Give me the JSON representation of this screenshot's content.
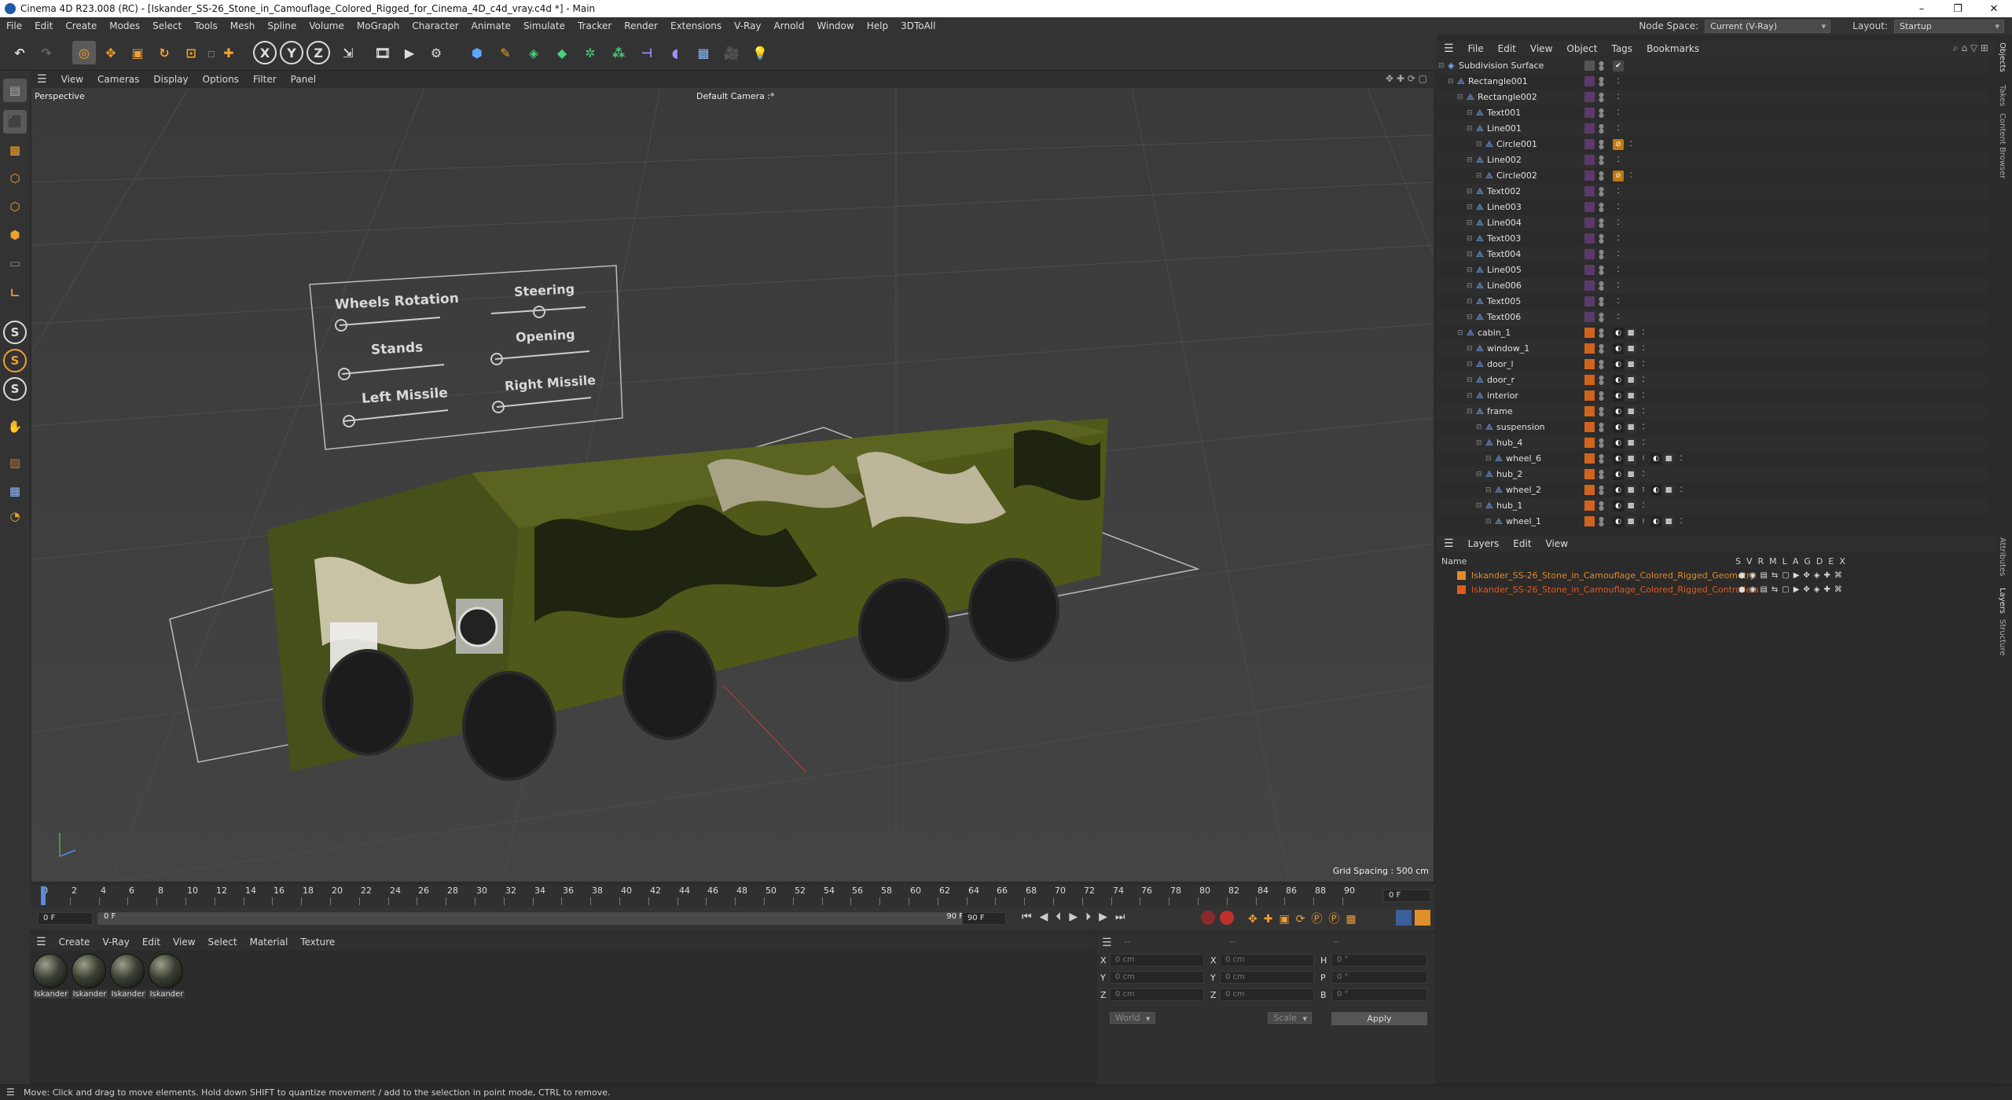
{
  "window": {
    "title": "Cinema 4D R23.008 (RC) - [Iskander_SS-26_Stone_in_Camouflage_Colored_Rigged_for_Cinema_4D_c4d_vray.c4d *] - Main",
    "min": "–",
    "max": "❐",
    "close": "✕"
  },
  "menubar": {
    "items": [
      "File",
      "Edit",
      "Create",
      "Modes",
      "Select",
      "Tools",
      "Mesh",
      "Spline",
      "Volume",
      "MoGraph",
      "Character",
      "Animate",
      "Simulate",
      "Tracker",
      "Render",
      "Extensions",
      "V-Ray",
      "Arnold",
      "Window",
      "Help",
      "3DToAll"
    ],
    "node_space_label": "Node Space:",
    "node_space_value": "Current (V-Ray)",
    "layout_label": "Layout:",
    "layout_value": "Startup"
  },
  "toolbar": {
    "axis": [
      "X",
      "Y",
      "Z"
    ]
  },
  "viewport": {
    "menu": [
      "View",
      "Cameras",
      "Display",
      "Options",
      "Filter",
      "Panel"
    ],
    "view_name": "Perspective",
    "camera": "Default Camera :*",
    "grid_spacing": "Grid Spacing : 500 cm",
    "hud": {
      "wheels_rotation": "Wheels Rotation",
      "steering": "Steering",
      "stands": "Stands",
      "opening": "Opening",
      "left_missile": "Left Missile",
      "right_missile": "Right Missile"
    }
  },
  "timeline": {
    "ticks": [
      "0",
      "2",
      "4",
      "6",
      "8",
      "10",
      "12",
      "14",
      "16",
      "18",
      "20",
      "22",
      "24",
      "26",
      "28",
      "30",
      "32",
      "34",
      "36",
      "38",
      "40",
      "42",
      "44",
      "46",
      "48",
      "50",
      "52",
      "54",
      "56",
      "58",
      "60",
      "62",
      "64",
      "66",
      "68",
      "70",
      "72",
      "74",
      "76",
      "78",
      "80",
      "82",
      "84",
      "86",
      "88",
      "90"
    ],
    "current_frame": "0 F",
    "start": "0 F",
    "range_start": "0 F",
    "range_end": "90 F",
    "end": "90 F"
  },
  "materials": {
    "menu": [
      "Create",
      "V-Ray",
      "Edit",
      "View",
      "Select",
      "Material",
      "Texture"
    ],
    "items": [
      "Iskander",
      "Iskander",
      "Iskander",
      "Iskander"
    ]
  },
  "coords": {
    "labels_left": [
      "X",
      "Y",
      "Z"
    ],
    "labels_mid": [
      "X",
      "Y",
      "Z"
    ],
    "labels_right": [
      "H",
      "P",
      "B"
    ],
    "values": [
      "0 cm",
      "0 cm",
      "0 cm"
    ],
    "rot_values": [
      "0 °",
      "0 °",
      "0 °"
    ],
    "world": "World",
    "scale": "Scale",
    "apply": "Apply",
    "dashes": "--"
  },
  "status": "Move: Click and drag to move elements. Hold down SHIFT to quantize movement / add to the selection in point mode, CTRL to remove.",
  "objects": {
    "menu": [
      "File",
      "Edit",
      "View",
      "Object",
      "Tags",
      "Bookmarks"
    ],
    "rows": [
      {
        "name": "Subdivision Surface",
        "indent": 0
      },
      {
        "name": "Rectangle001",
        "indent": 1
      },
      {
        "name": "Rectangle002",
        "indent": 2
      },
      {
        "name": "Text001",
        "indent": 3
      },
      {
        "name": "Line001",
        "indent": 3
      },
      {
        "name": "Circle001",
        "indent": 4
      },
      {
        "name": "Line002",
        "indent": 3
      },
      {
        "name": "Circle002",
        "indent": 4
      },
      {
        "name": "Text002",
        "indent": 3
      },
      {
        "name": "Line003",
        "indent": 3
      },
      {
        "name": "Line004",
        "indent": 3
      },
      {
        "name": "Text003",
        "indent": 3
      },
      {
        "name": "Text004",
        "indent": 3
      },
      {
        "name": "Line005",
        "indent": 3
      },
      {
        "name": "Line006",
        "indent": 3
      },
      {
        "name": "Text005",
        "indent": 3
      },
      {
        "name": "Text006",
        "indent": 3
      },
      {
        "name": "cabin_1",
        "indent": 2
      },
      {
        "name": "window_1",
        "indent": 3
      },
      {
        "name": "door_l",
        "indent": 3
      },
      {
        "name": "door_r",
        "indent": 3
      },
      {
        "name": "interior",
        "indent": 3
      },
      {
        "name": "frame",
        "indent": 3
      },
      {
        "name": "suspension",
        "indent": 4
      },
      {
        "name": "hub_4",
        "indent": 4
      },
      {
        "name": "wheel_6",
        "indent": 5
      },
      {
        "name": "hub_2",
        "indent": 4
      },
      {
        "name": "wheel_2",
        "indent": 5
      },
      {
        "name": "hub_1",
        "indent": 4
      },
      {
        "name": "wheel_1",
        "indent": 5
      }
    ]
  },
  "layers": {
    "menu": [
      "Layers",
      "Edit",
      "View"
    ],
    "col_name": "Name",
    "cols": [
      "S",
      "V",
      "R",
      "M",
      "L",
      "A",
      "G",
      "D",
      "E",
      "X"
    ],
    "rows": [
      "Iskander_SS-26_Stone_in_Camouflage_Colored_Rigged_Geometry",
      "Iskander_SS-26_Stone_in_Camouflage_Colored_Rigged_Controllers"
    ]
  },
  "right_tabs": [
    "Objects",
    "Takes",
    "Content Browser",
    "Attributes",
    "Layers",
    "Structure"
  ],
  "colors": {
    "accent": "#e07a1f",
    "layer_geo": "#e08a2a",
    "layer_ctrl": "#e05a20"
  }
}
